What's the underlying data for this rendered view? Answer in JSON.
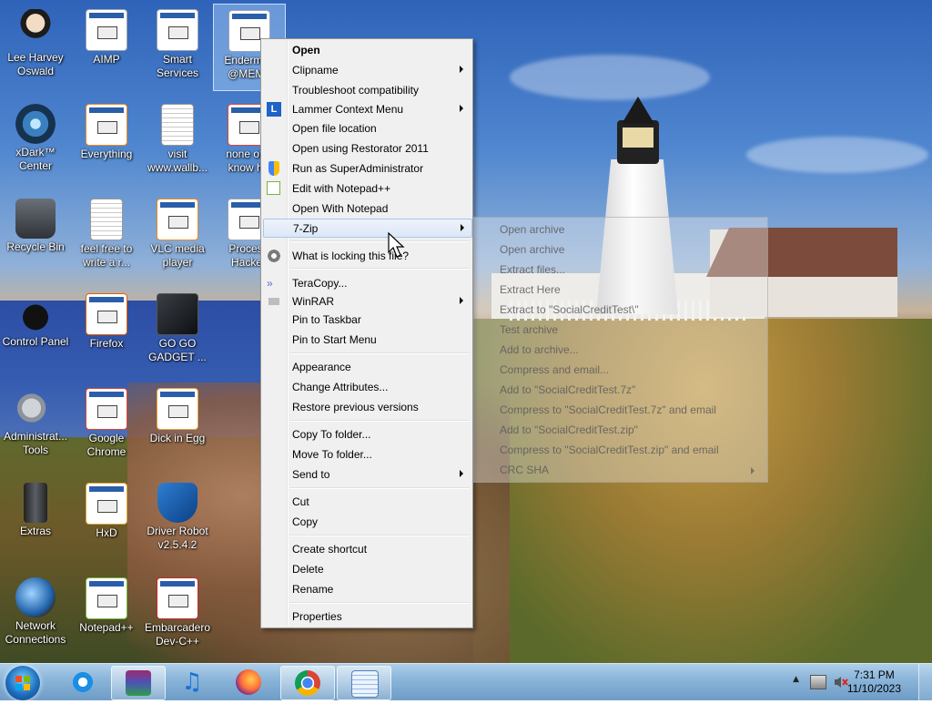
{
  "desktop_icons": [
    {
      "label": "Lee Harvey Oswald",
      "icon": "avatar-figure-icon"
    },
    {
      "label": "AIMP",
      "icon": "aimp-icon"
    },
    {
      "label": "Smart Services",
      "icon": "gear-icon"
    },
    {
      "label": "Enderman @MEMZ",
      "icon": "exe-icon"
    },
    {
      "label": "xDark™ Center",
      "icon": "xdark-icon"
    },
    {
      "label": "Everything",
      "icon": "search-icon"
    },
    {
      "label": "visit www.wallb...",
      "icon": "text-file-icon"
    },
    {
      "label": "none of y know ho",
      "icon": "chrome-shortcut-icon"
    },
    {
      "label": "Recycle Bin",
      "icon": "recycle-bin-icon"
    },
    {
      "label": "feel free to write a r...",
      "icon": "text-file-icon"
    },
    {
      "label": "VLC media player",
      "icon": "vlc-icon"
    },
    {
      "label": "Process Hacker",
      "icon": "exe-icon"
    },
    {
      "label": "Control Panel",
      "icon": "control-panel-icon"
    },
    {
      "label": "Firefox",
      "icon": "firefox-icon"
    },
    {
      "label": "GO GO GADGET ...",
      "icon": "gadget-icon"
    },
    {
      "label": "Administrat... Tools",
      "icon": "admin-tools-icon"
    },
    {
      "label": "Google Chrome",
      "icon": "chrome-icon"
    },
    {
      "label": "Dick in Egg",
      "icon": "exe-icon"
    },
    {
      "label": "Extras",
      "icon": "extras-icon"
    },
    {
      "label": "HxD",
      "icon": "hxd-icon"
    },
    {
      "label": "Driver Robot v2.5.4.2",
      "icon": "shield-icon"
    },
    {
      "label": "Network Connections",
      "icon": "network-icon"
    },
    {
      "label": "Notepad++",
      "icon": "notepad-plus-icon"
    },
    {
      "label": "Embarcadero Dev-C++",
      "icon": "devcpp-icon"
    }
  ],
  "context_menu": {
    "items": [
      {
        "label": "Open",
        "bold": true
      },
      {
        "label": "Clipname",
        "submenu": true
      },
      {
        "label": "Troubleshoot compatibility"
      },
      {
        "label": "Lammer Context Menu",
        "submenu": true,
        "icon": "lammer-icon"
      },
      {
        "label": "Open file location"
      },
      {
        "label": "Open using Restorator 2011"
      },
      {
        "label": "Run as SuperAdministrator",
        "icon": "shield-icon"
      },
      {
        "label": "Edit with Notepad++",
        "icon": "notepad-plus-icon"
      },
      {
        "label": "Open With Notepad"
      },
      {
        "label": "7-Zip",
        "submenu": true,
        "highlighted": true
      },
      {
        "label": "What is locking this file?",
        "icon": "gear-icon"
      },
      {
        "label": "TeraCopy...",
        "icon": "teracopy-icon"
      },
      {
        "label": "WinRAR",
        "submenu": true,
        "icon": "winrar-icon"
      },
      {
        "label": "Pin to Taskbar"
      },
      {
        "label": "Pin to Start Menu"
      },
      {
        "label": "Appearance"
      },
      {
        "label": "Change Attributes..."
      },
      {
        "label": "Restore previous versions"
      },
      {
        "label": "Copy To folder..."
      },
      {
        "label": "Move To folder..."
      },
      {
        "label": "Send to",
        "submenu": true
      },
      {
        "label": "Cut"
      },
      {
        "label": "Copy"
      },
      {
        "label": "Create shortcut"
      },
      {
        "label": "Delete"
      },
      {
        "label": "Rename"
      },
      {
        "label": "Properties"
      }
    ]
  },
  "zip_submenu": {
    "items": [
      "Open archive",
      "Open archive",
      "Extract files...",
      "Extract Here",
      "Extract to \"SocialCreditTest\\\"",
      "Test archive",
      "Add to archive...",
      "Compress and email...",
      "Add to \"SocialCreditTest.7z\"",
      "Compress to \"SocialCreditTest.7z\" and email",
      "Add to \"SocialCreditTest.zip\"",
      "Compress to \"SocialCreditTest.zip\" and email",
      "CRC SHA"
    ]
  },
  "taskbar": {
    "pinned": [
      {
        "name": "internet-explorer-icon"
      },
      {
        "name": "winrar-archive-icon"
      },
      {
        "name": "itunes-icon"
      },
      {
        "name": "firefox-icon"
      },
      {
        "name": "chrome-icon"
      },
      {
        "name": "notepad-icon"
      }
    ],
    "clock_time": "7:31 PM",
    "clock_date": "11/10/2023"
  },
  "colors": {
    "menu_bg": "#f0f0f0",
    "highlight": "#dce7f7",
    "taskbar": "#8cb6da"
  }
}
